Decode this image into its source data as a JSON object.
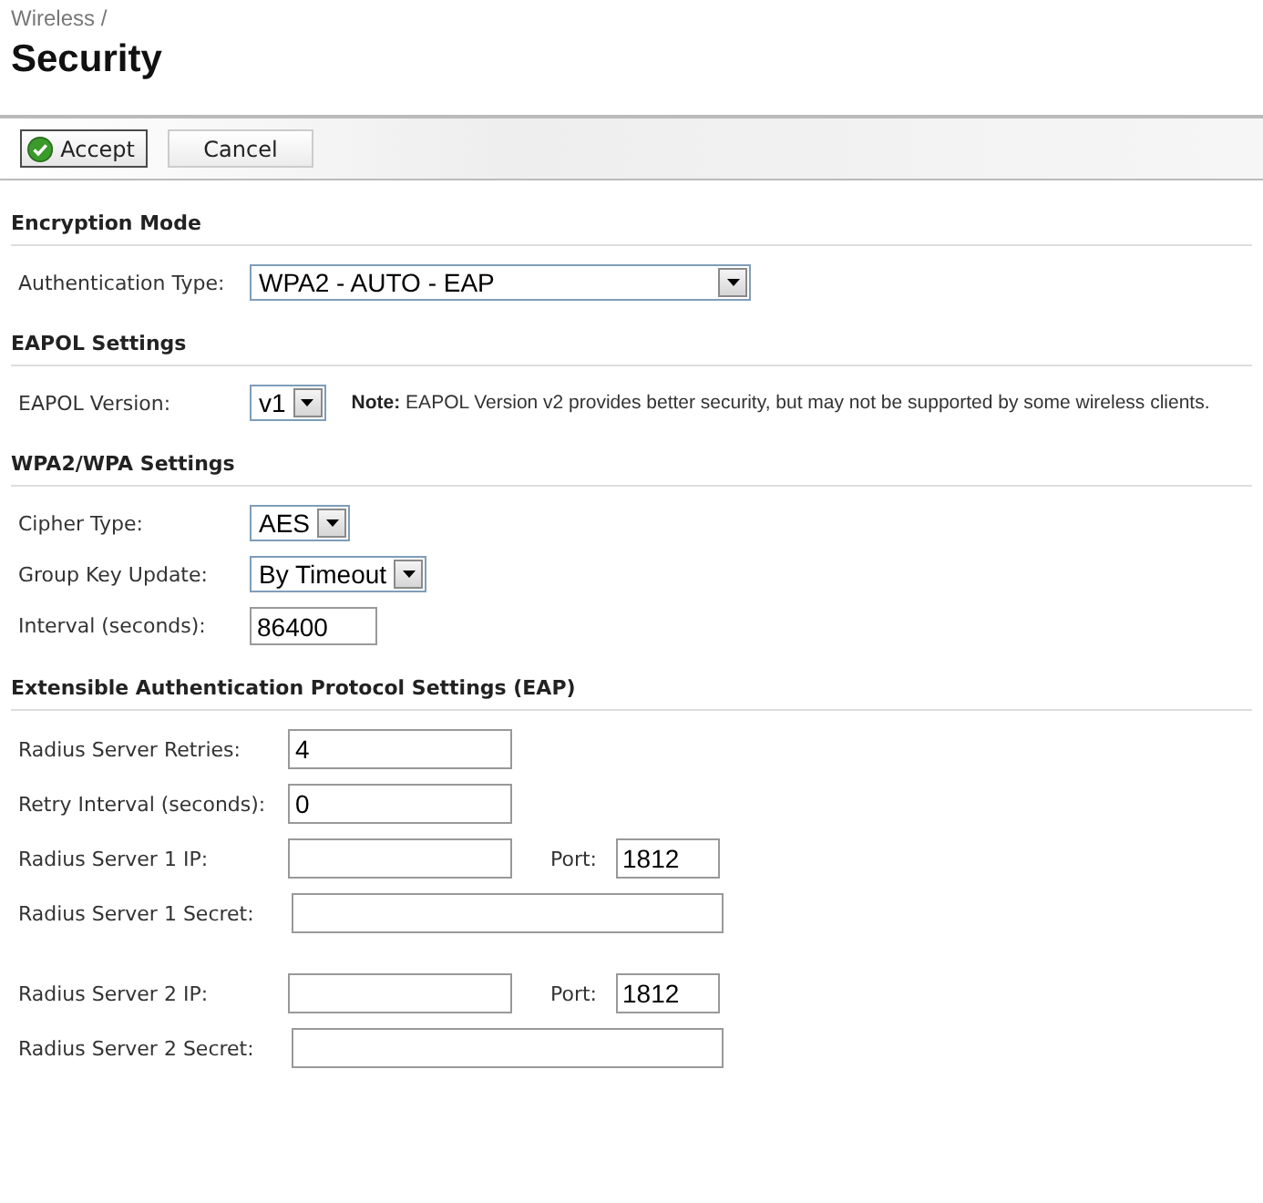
{
  "breadcrumb": "Wireless /",
  "title": "Security",
  "toolbar": [
    {
      "label": "Accept",
      "kind": "primary"
    },
    {
      "label": "Cancel",
      "kind": "plain"
    }
  ],
  "sections": [
    {
      "heading": "Encryption Mode",
      "groups": [
        [
          {
            "kind": "select-wide",
            "label": "Authentication Type:",
            "value": "WPA2 - AUTO - EAP"
          }
        ]
      ]
    },
    {
      "heading": "EAPOL Settings",
      "groups": [
        [
          {
            "kind": "select",
            "label": "EAPOL Version:",
            "value": "v1",
            "note": "**Note:** EAPOL Version v2 provides better security, but may not be supported by some wireless clients."
          }
        ]
      ]
    },
    {
      "heading": "WPA2/WPA Settings",
      "groups": [
        [
          {
            "kind": "select",
            "label": "Cipher Type:",
            "value": "AES"
          },
          {
            "kind": "select",
            "label": "Group Key Update:",
            "value": "By Timeout"
          },
          {
            "kind": "number",
            "label": "Interval (seconds):",
            "value": "86400"
          }
        ]
      ]
    },
    {
      "heading": "Extensible Authentication Protocol Settings (EAP)",
      "groups": [
        [
          {
            "kind": "text",
            "label": "Radius Server Retries:",
            "value": "4"
          },
          {
            "kind": "text",
            "label": "Retry Interval (seconds):",
            "value": "0"
          },
          {
            "kind": "text-port",
            "label": "Radius Server 1 IP:",
            "port_label": "Port:",
            "port": "1812"
          },
          {
            "kind": "text-long",
            "label": "Radius Server 1 Secret:"
          }
        ],
        [
          {
            "kind": "text-port",
            "label": "Radius Server 2 IP:",
            "port_label": "Port:",
            "port": "1812"
          },
          {
            "kind": "text-long",
            "label": "Radius Server 2 Secret:"
          }
        ]
      ]
    }
  ]
}
